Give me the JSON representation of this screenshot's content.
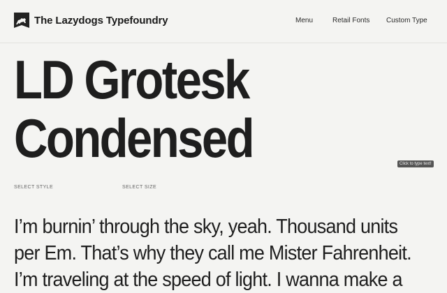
{
  "header": {
    "brand": "The Lazydogs Typefoundry",
    "logo_icon": "lazydog-logo-icon",
    "nav": [
      "Menu",
      "Retail Fonts",
      "Custom Type"
    ]
  },
  "hero": {
    "line1": "LD Grotesk",
    "line2": "Condensed"
  },
  "tooltip": "Click to type text!",
  "controls": {
    "style_label": "SELECT STYLE",
    "size_label": "SELECT SIZE"
  },
  "sample_text": "I’m burnin’ through the sky, yeah. Thousand units per Em. That’s why they call me Mister Fahrenheit. I’m traveling at the speed of light. I wanna make a",
  "colors": {
    "background": "#f4f4f2",
    "text": "#1e1e1e",
    "tooltip_bg": "#555555"
  }
}
